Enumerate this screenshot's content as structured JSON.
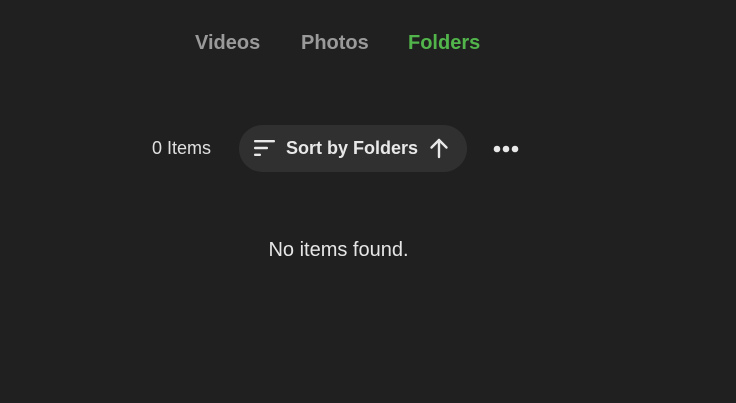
{
  "tabs": [
    {
      "label": "Videos",
      "active": false
    },
    {
      "label": "Photos",
      "active": false
    },
    {
      "label": "Folders",
      "active": true
    }
  ],
  "toolbar": {
    "item_count": "0 Items",
    "sort_label": "Sort by Folders",
    "sort_icon": "sort-lines-icon",
    "sort_direction_icon": "arrow-up-icon",
    "more_icon": "more-horizontal-icon"
  },
  "empty_state": {
    "message": "No items found."
  },
  "colors": {
    "background": "#202020",
    "accent": "#52b54b",
    "inactive_tab": "#9a9a9a",
    "button_bg": "#303030",
    "text": "#e6e6e6"
  }
}
